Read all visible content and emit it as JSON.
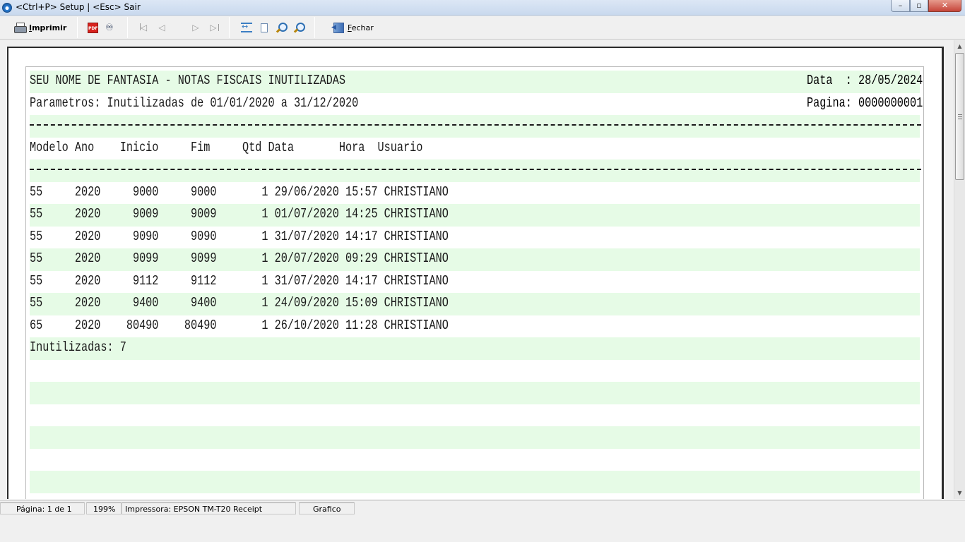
{
  "window": {
    "title": "<Ctrl+P> Setup | <Esc> Sair",
    "min_label": "–",
    "max_label": "▫",
    "close_label": "✕"
  },
  "toolbar": {
    "print_label": "Imprimir",
    "print_mnemonic": "I",
    "print_rest": "mprimir",
    "pdf_label": "PDF",
    "close_label": "Fechar",
    "close_mnemonic": "F",
    "close_rest": "echar",
    "icons": [
      "printer-icon",
      "pdf-icon",
      "binoculars-icon",
      "first-page-icon",
      "previous-page-icon",
      "next-page-icon",
      "last-page-icon",
      "fit-width-icon",
      "whole-page-icon",
      "zoom-in-icon",
      "zoom-out-icon",
      "exit-icon"
    ]
  },
  "report": {
    "title": "SEU NOME DE FANTASIA - NOTAS FISCAIS INUTILIZADAS",
    "date_label": "Data  : 28/05/2024",
    "params": "Parametros: Inutilizadas de 01/01/2020 a 31/12/2020",
    "page_label": "Pagina: 0000000001",
    "columns": [
      "Modelo",
      "Ano",
      "Inicio",
      "Fim",
      "Qtd",
      "Data",
      "Hora",
      "Usuario"
    ],
    "header_line": "Modelo Ano    Inicio     Fim     Qtd Data       Hora  Usuario",
    "rows": [
      {
        "modelo": "55",
        "ano": "2020",
        "inicio": "9000",
        "fim": "9000",
        "qtd": "1",
        "data": "29/06/2020",
        "hora": "15:57",
        "usuario": "CHRISTIANO",
        "line": "55     2020     9000     9000       1 29/06/2020 15:57 CHRISTIANO"
      },
      {
        "modelo": "55",
        "ano": "2020",
        "inicio": "9009",
        "fim": "9009",
        "qtd": "1",
        "data": "01/07/2020",
        "hora": "14:25",
        "usuario": "CHRISTIANO",
        "line": "55     2020     9009     9009       1 01/07/2020 14:25 CHRISTIANO"
      },
      {
        "modelo": "55",
        "ano": "2020",
        "inicio": "9090",
        "fim": "9090",
        "qtd": "1",
        "data": "31/07/2020",
        "hora": "14:17",
        "usuario": "CHRISTIANO",
        "line": "55     2020     9090     9090       1 31/07/2020 14:17 CHRISTIANO"
      },
      {
        "modelo": "55",
        "ano": "2020",
        "inicio": "9099",
        "fim": "9099",
        "qtd": "1",
        "data": "20/07/2020",
        "hora": "09:29",
        "usuario": "CHRISTIANO",
        "line": "55     2020     9099     9099       1 20/07/2020 09:29 CHRISTIANO"
      },
      {
        "modelo": "55",
        "ano": "2020",
        "inicio": "9112",
        "fim": "9112",
        "qtd": "1",
        "data": "31/07/2020",
        "hora": "14:17",
        "usuario": "CHRISTIANO",
        "line": "55     2020     9112     9112       1 31/07/2020 14:17 CHRISTIANO"
      },
      {
        "modelo": "55",
        "ano": "2020",
        "inicio": "9400",
        "fim": "9400",
        "qtd": "1",
        "data": "24/09/2020",
        "hora": "15:09",
        "usuario": "CHRISTIANO",
        "line": "55     2020     9400     9400       1 24/09/2020 15:09 CHRISTIANO"
      },
      {
        "modelo": "65",
        "ano": "2020",
        "inicio": "80490",
        "fim": "80490",
        "qtd": "1",
        "data": "26/10/2020",
        "hora": "11:28",
        "usuario": "CHRISTIANO",
        "line": "65     2020    80490    80490       1 26/10/2020 11:28 CHRISTIANO"
      }
    ],
    "total_line": "Inutilizadas: 7",
    "band_color": "#e6fbe6"
  },
  "statusbar": {
    "page": "Página: 1 de 1",
    "zoom": "199%",
    "printer": "Impressora: EPSON TM-T20 Receipt",
    "mode": "Grafico"
  }
}
